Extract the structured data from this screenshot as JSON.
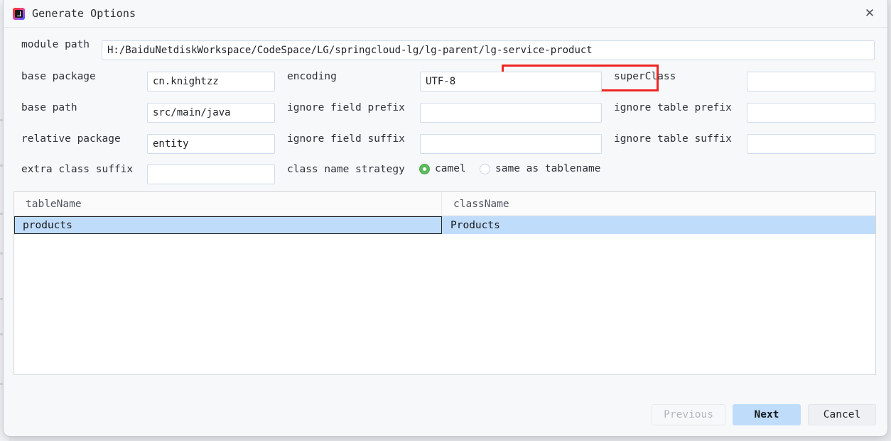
{
  "window": {
    "title": "Generate Options",
    "app_icon": "intellij-idea-icon",
    "close_label": "✕"
  },
  "form": {
    "module_path": {
      "label": "module path",
      "value": "H:/BaiduNetdiskWorkspace/CodeSpace/LG/springcloud-lg/lg-parent/lg-service-product",
      "placeholder": ""
    },
    "base_package": {
      "label": "base package",
      "value": "cn.knightzz",
      "placeholder": ""
    },
    "encoding": {
      "label": "encoding",
      "value": "UTF-8",
      "placeholder": ""
    },
    "super_class": {
      "label": "superClass",
      "value": "",
      "placeholder": ""
    },
    "base_path": {
      "label": "base path",
      "value": "src/main/java",
      "placeholder": ""
    },
    "ignore_field_prefix": {
      "label": "ignore field prefix",
      "value": "",
      "placeholder": ""
    },
    "ignore_table_prefix": {
      "label": "ignore table prefix",
      "value": "",
      "placeholder": ""
    },
    "relative_package": {
      "label": "relative package",
      "value": "entity",
      "placeholder": ""
    },
    "ignore_field_suffix": {
      "label": "ignore field suffix",
      "value": "",
      "placeholder": ""
    },
    "ignore_table_suffix": {
      "label": "ignore table suffix",
      "value": "",
      "placeholder": ""
    },
    "extra_class_suffix": {
      "label": "extra class suffix",
      "value": "",
      "placeholder": ""
    },
    "class_name_strategy": {
      "label": "class name strategy",
      "selected": "camel",
      "options": [
        {
          "value": "camel",
          "label": "camel",
          "selected": true
        },
        {
          "value": "same_as_tablename",
          "label": "same as tablename",
          "selected": false
        }
      ]
    }
  },
  "annotation": {
    "highlight_color": "#ee2524",
    "highlight_target": "/lg-service-product"
  },
  "table": {
    "columns": [
      "tableName",
      "className"
    ],
    "rows": [
      {
        "tableName": "products",
        "className": "Products",
        "selected": true
      }
    ]
  },
  "buttons": {
    "previous": {
      "label": "Previous",
      "state": "disabled"
    },
    "next": {
      "label": "Next",
      "state": "default"
    },
    "cancel": {
      "label": "Cancel",
      "state": "normal"
    }
  },
  "colors": {
    "dialog_bg": "#f7f8fa",
    "field_border": "#cfdcea",
    "selection_blue": "#bfdcfb",
    "radio_green": "#5cbb5c",
    "annotation_red": "#ee2524"
  }
}
